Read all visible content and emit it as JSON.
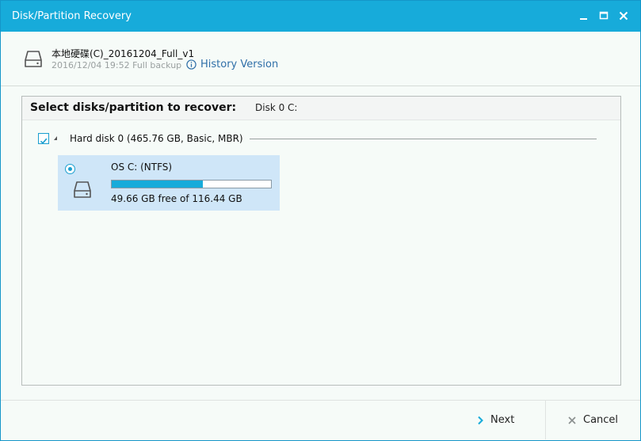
{
  "window": {
    "title": "Disk/Partition Recovery",
    "controls": [
      "minimize",
      "maximize",
      "close"
    ]
  },
  "header": {
    "backup_name": "本地硬碟(C)_20161204_Full_v1",
    "backup_meta": "2016/12/04 19:52 Full backup",
    "history_label": "History Version"
  },
  "panel": {
    "label": "Select disks/partition to recover:",
    "selected": "Disk 0 C:",
    "disk": {
      "label": "Hard disk 0 (465.76 GB, Basic, MBR)",
      "checked": true
    },
    "partition": {
      "name": "OS C: (NTFS)",
      "free": "49.66 GB free of 116.44 GB",
      "used_fraction": 0.574,
      "selected": true
    }
  },
  "footer": {
    "next_label": "Next",
    "cancel_label": "Cancel"
  },
  "colors": {
    "accent": "#17abda",
    "link": "#2f6fa8",
    "selection": "#cfe6f8"
  }
}
